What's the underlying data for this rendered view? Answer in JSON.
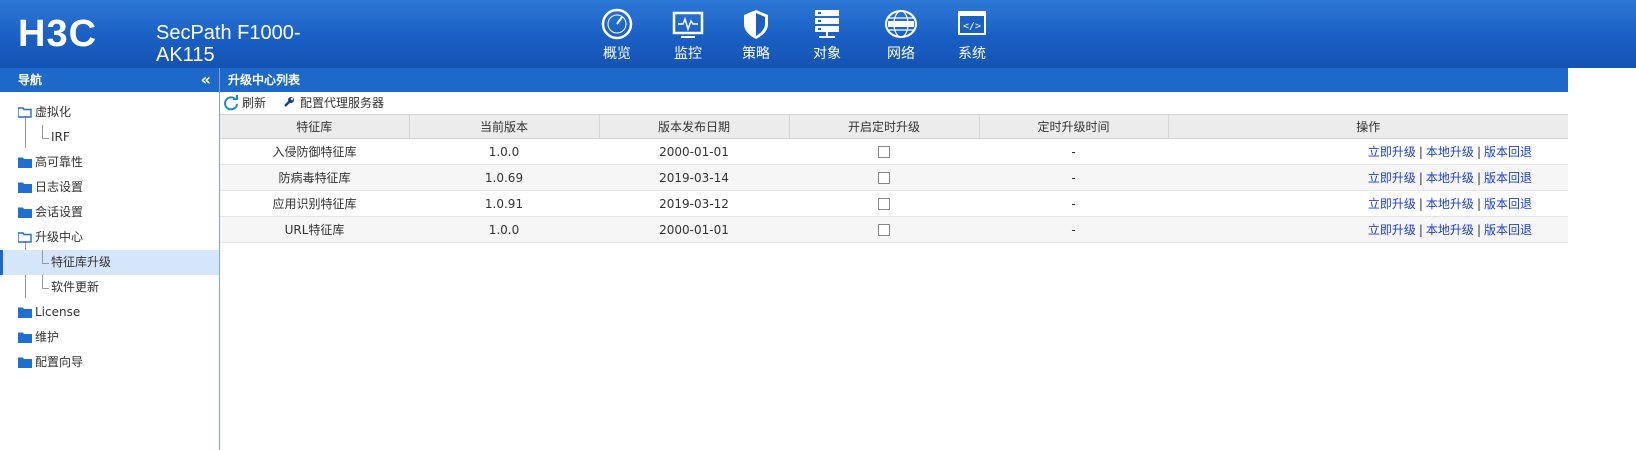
{
  "header": {
    "logo": "H3C",
    "product": "SecPath F1000-AK115",
    "nav": [
      {
        "label": "概览",
        "icon": "dashboard-gauge-icon"
      },
      {
        "label": "监控",
        "icon": "monitor-icon"
      },
      {
        "label": "策略",
        "icon": "shield-icon"
      },
      {
        "label": "对象",
        "icon": "server-stack-icon"
      },
      {
        "label": "网络",
        "icon": "internet-globe-icon"
      },
      {
        "label": "系统",
        "icon": "code-window-icon"
      }
    ]
  },
  "sidebar": {
    "title": "导航",
    "collapse": "«",
    "items": [
      {
        "label": "虚拟化",
        "level": 0,
        "open": true
      },
      {
        "label": "IRF",
        "level": 1
      },
      {
        "label": "高可靠性",
        "level": 0
      },
      {
        "label": "日志设置",
        "level": 0
      },
      {
        "label": "会话设置",
        "level": 0
      },
      {
        "label": "升级中心",
        "level": 0,
        "open": true
      },
      {
        "label": "特征库升级",
        "level": 1,
        "selected": true
      },
      {
        "label": "软件更新",
        "level": 1
      },
      {
        "label": "License",
        "level": 0
      },
      {
        "label": "维护",
        "level": 0
      },
      {
        "label": "配置向导",
        "level": 0
      }
    ]
  },
  "main": {
    "title": "升级中心列表",
    "toolbar": {
      "refresh": "刷新",
      "proxy": "配置代理服务器"
    },
    "columns": [
      "特征库",
      "当前版本",
      "版本发布日期",
      "开启定时升级",
      "定时升级时间",
      "操作"
    ],
    "rows": [
      {
        "name": "入侵防御特征库",
        "version": "1.0.0",
        "date": "2000-01-01",
        "scheduled": false,
        "time": "-"
      },
      {
        "name": "防病毒特征库",
        "version": "1.0.69",
        "date": "2019-03-14",
        "scheduled": false,
        "time": "-"
      },
      {
        "name": "应用识别特征库",
        "version": "1.0.91",
        "date": "2019-03-12",
        "scheduled": false,
        "time": "-"
      },
      {
        "name": "URL特征库",
        "version": "1.0.0",
        "date": "2000-01-01",
        "scheduled": false,
        "time": "-"
      }
    ],
    "ops": {
      "upgrade_now": "立即升级",
      "local_upgrade": "本地升级",
      "rollback": "版本回退",
      "separator": "|"
    }
  },
  "colors": {
    "header": "#1a5fc4",
    "title_bar": "#1d68c9",
    "link": "#1a3fd6",
    "selected": "#d5e6fa",
    "folder": "#1f6fd0"
  }
}
